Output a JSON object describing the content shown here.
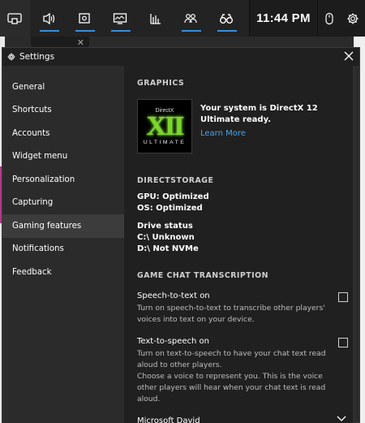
{
  "gamebar": {
    "time": "11:44 PM",
    "widget_icons": [
      "audio-icon",
      "capture-icon",
      "performance-icon",
      "resources-icon",
      "xbox-social-icon",
      "looking-for-group-icon"
    ]
  },
  "settings": {
    "title": "Settings",
    "nav": [
      {
        "label": "General"
      },
      {
        "label": "Shortcuts"
      },
      {
        "label": "Accounts"
      },
      {
        "label": "Widget menu"
      },
      {
        "label": "Personalization"
      },
      {
        "label": "Capturing"
      },
      {
        "label": "Gaming features",
        "active": true
      },
      {
        "label": "Notifications"
      },
      {
        "label": "Feedback"
      }
    ],
    "graphics": {
      "heading": "GRAPHICS",
      "logo_top": "DirectX",
      "logo_main": "XII",
      "logo_bottom": "ULTIMATE",
      "status": "Your system is DirectX 12 Ultimate ready.",
      "link": "Learn More"
    },
    "directstorage": {
      "heading": "DIRECTSTORAGE",
      "gpu": "GPU: Optimized",
      "os": "OS: Optimized",
      "drive_title": "Drive status",
      "drive_c": "C:\\ Unknown",
      "drive_d": "D:\\ Not NVMe"
    },
    "chat": {
      "heading": "GAME CHAT TRANSCRIPTION",
      "stt_title": "Speech-to-text on",
      "stt_desc": "Turn on speech-to-text to transcribe other players' voices into text on your device.",
      "tts_title": "Text-to-speech on",
      "tts_desc1": "Turn on text-to-speech to have your chat text read aloud to other players.",
      "tts_desc2": "Choose a voice to represent you. This is the voice other players will hear when your chat text is read aloud.",
      "voice": "Microsoft David"
    }
  },
  "colors": {
    "accent": "#3b8ed7",
    "link": "#4da3e8",
    "directx_green": "#7bd62c"
  }
}
